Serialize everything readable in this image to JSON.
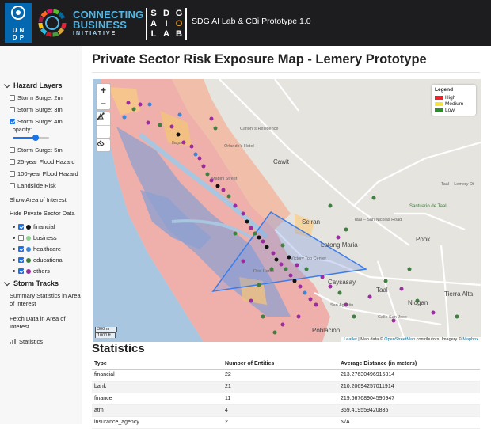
{
  "header": {
    "undp_letters": [
      "U",
      "N",
      "D",
      "P"
    ],
    "cbi_line1": "CONNECTING",
    "cbi_line2": "BUSINESS",
    "cbi_line3": "INITIATIVE",
    "sdg_letters": [
      "S",
      "D",
      "G",
      "A",
      "I",
      "O",
      "L",
      "A",
      "B"
    ],
    "app_title": "SDG AI Lab & CBi Prototype 1.0"
  },
  "sidebar": {
    "hazard_title": "Hazard Layers",
    "layers": [
      {
        "label": "Storm Surge: 2m",
        "checked": false
      },
      {
        "label": "Storm Surge: 3m",
        "checked": false
      },
      {
        "label": "Storm Surge: 4m",
        "checked": true
      },
      {
        "label": "Storm Surge: 5m",
        "checked": false
      },
      {
        "label": "25-year Flood Hazard",
        "checked": false
      },
      {
        "label": "100-year Flood Hazard",
        "checked": false
      },
      {
        "label": "Landslide Risk",
        "checked": false
      }
    ],
    "opacity_label": "opacity:",
    "opacity_value": 0.65,
    "show_area": "Show Area of Interest",
    "hide_private": "Hide Private Sector Data",
    "entities": [
      {
        "label": "financial",
        "checked": true,
        "color": "#111111"
      },
      {
        "label": "business",
        "checked": false,
        "color": "#8fd18f"
      },
      {
        "label": "healthcare",
        "checked": true,
        "color": "#3a86d8"
      },
      {
        "label": "educational",
        "checked": true,
        "color": "#3f7f3f"
      },
      {
        "label": "others",
        "checked": true,
        "color": "#9c2aa0"
      }
    ],
    "storm_title": "Storm Tracks",
    "summary_link": "Summary Statistics in Area of Interest",
    "fetch_link": "Fetch Data in Area of Interest",
    "stats_link": "Statistics"
  },
  "main": {
    "title": "Private Sector Risk Exposure Map - Lemery Prototype"
  },
  "map": {
    "zoom_in": "+",
    "zoom_out": "−",
    "legend": {
      "title": "Legend",
      "items": [
        {
          "label": "High",
          "color": "#e8252a"
        },
        {
          "label": "Medium",
          "color": "#f5e53a"
        },
        {
          "label": "Low",
          "color": "#2e8b2e"
        }
      ]
    },
    "labels": {
      "cawit": "Cawit",
      "seiran": "Seiran",
      "latong_maria": "Latong Maria",
      "pook": "Pook",
      "caysasay": "Caysasay",
      "taal": "Taal",
      "niogan": "Niogan",
      "tierra_alta": "Tierra Alta",
      "poblacion": "Poblacion",
      "calle_san_jose": "Calle San Jose",
      "santuario": "Santuario de Taal",
      "taal_lemery": "Taal – Lemery Di",
      "taal_san_nicolas": "Taal – San Nicolas Road",
      "cafloni": "Cafloni's Residence",
      "orlando": "Orlando's Hotel",
      "mabini": "Mabini Street",
      "ilagan": "Ilagan",
      "victory": "Victory Top Center",
      "san_agustin": "San Agustin",
      "red_horse": "Red Horse"
    },
    "scale": [
      "300 m",
      "1000 ft"
    ],
    "attribution_leaflet": "Leaflet",
    "attribution_text": " | Map data © ",
    "attribution_osm": "OpenStreetMap",
    "attribution_mid": " contributors, Imagery © ",
    "attribution_mapbox": "Mapbox"
  },
  "statistics": {
    "title": "Statistics",
    "headers": [
      "Type",
      "Number of Entities",
      "Average Distance (in meters)"
    ],
    "rows": [
      [
        "financial",
        "22",
        "213.27630496916814"
      ],
      [
        "bank",
        "21",
        "210.20694257011914"
      ],
      [
        "finance",
        "11",
        "219.66768904590947"
      ],
      [
        "atm",
        "4",
        "369.419559420835"
      ],
      [
        "insurance_agency",
        "2",
        "N/A"
      ]
    ]
  }
}
